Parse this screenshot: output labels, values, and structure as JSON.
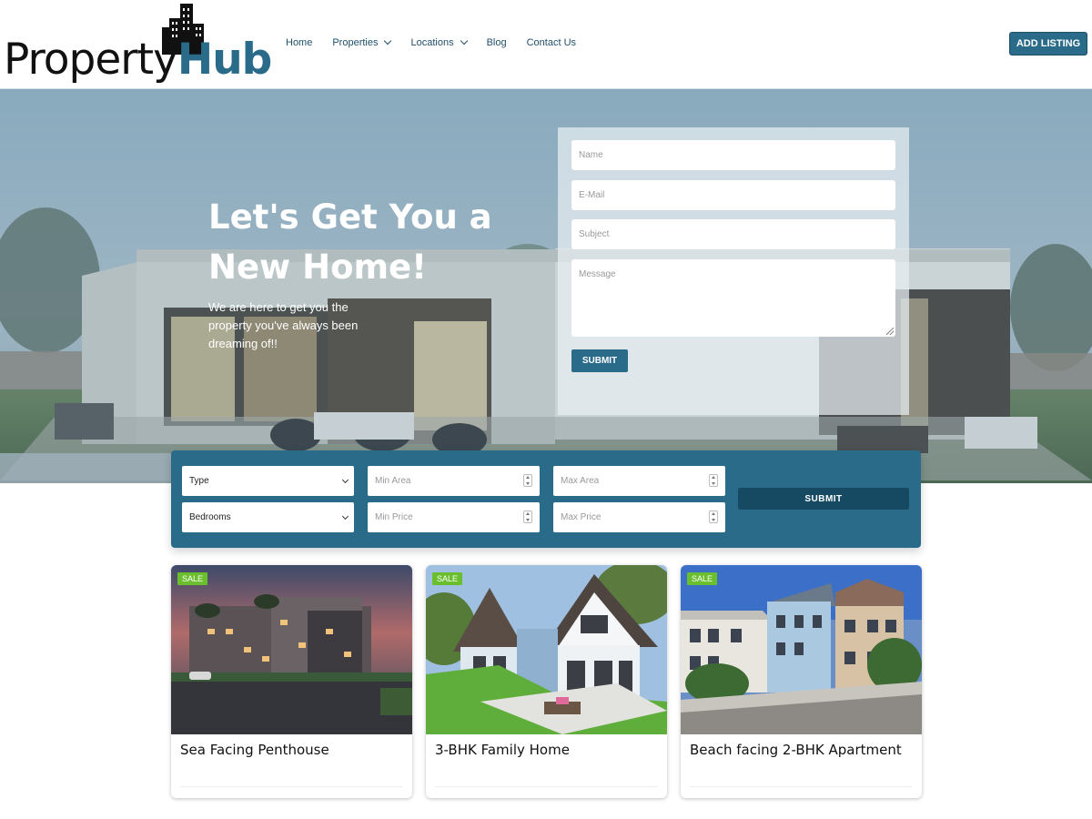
{
  "brand": {
    "part1": "Property",
    "part2": "Hub",
    "accent": "#2a6b8a"
  },
  "nav": {
    "items": [
      {
        "label": "Home",
        "dropdown": false
      },
      {
        "label": "Properties",
        "dropdown": true
      },
      {
        "label": "Locations",
        "dropdown": true
      },
      {
        "label": "Blog",
        "dropdown": false
      },
      {
        "label": "Contact Us",
        "dropdown": false
      }
    ],
    "cta_label": "ADD LISTING"
  },
  "hero": {
    "title": "Let's Get You a New Home!",
    "subtitle": "We are here to get you the property you've always been dreaming of!!"
  },
  "contact_form": {
    "name_placeholder": "Name",
    "email_placeholder": "E-Mail",
    "subject_placeholder": "Subject",
    "message_placeholder": "Message",
    "submit_label": "SUBMIT"
  },
  "search": {
    "type_label": "Type",
    "bedrooms_label": "Bedrooms",
    "min_area_placeholder": "Min Area",
    "max_area_placeholder": "Max Area",
    "min_price_placeholder": "Min Price",
    "max_price_placeholder": "Max Price",
    "submit_label": "SUBMIT"
  },
  "listings": [
    {
      "badge": "SALE",
      "title": "Sea Facing Penthouse"
    },
    {
      "badge": "SALE",
      "title": "3-BHK Family Home"
    },
    {
      "badge": "SALE",
      "title": "Beach facing 2-BHK Apartment"
    }
  ],
  "colors": {
    "primary": "#2a6b8a",
    "dark_primary": "#164a63",
    "sale_badge": "#6bbf2f"
  },
  "icons": [
    "building-logo-icon",
    "chevron-down-icon",
    "select-arrow-icon",
    "number-spinner-icon",
    "textarea-resize-icon"
  ]
}
